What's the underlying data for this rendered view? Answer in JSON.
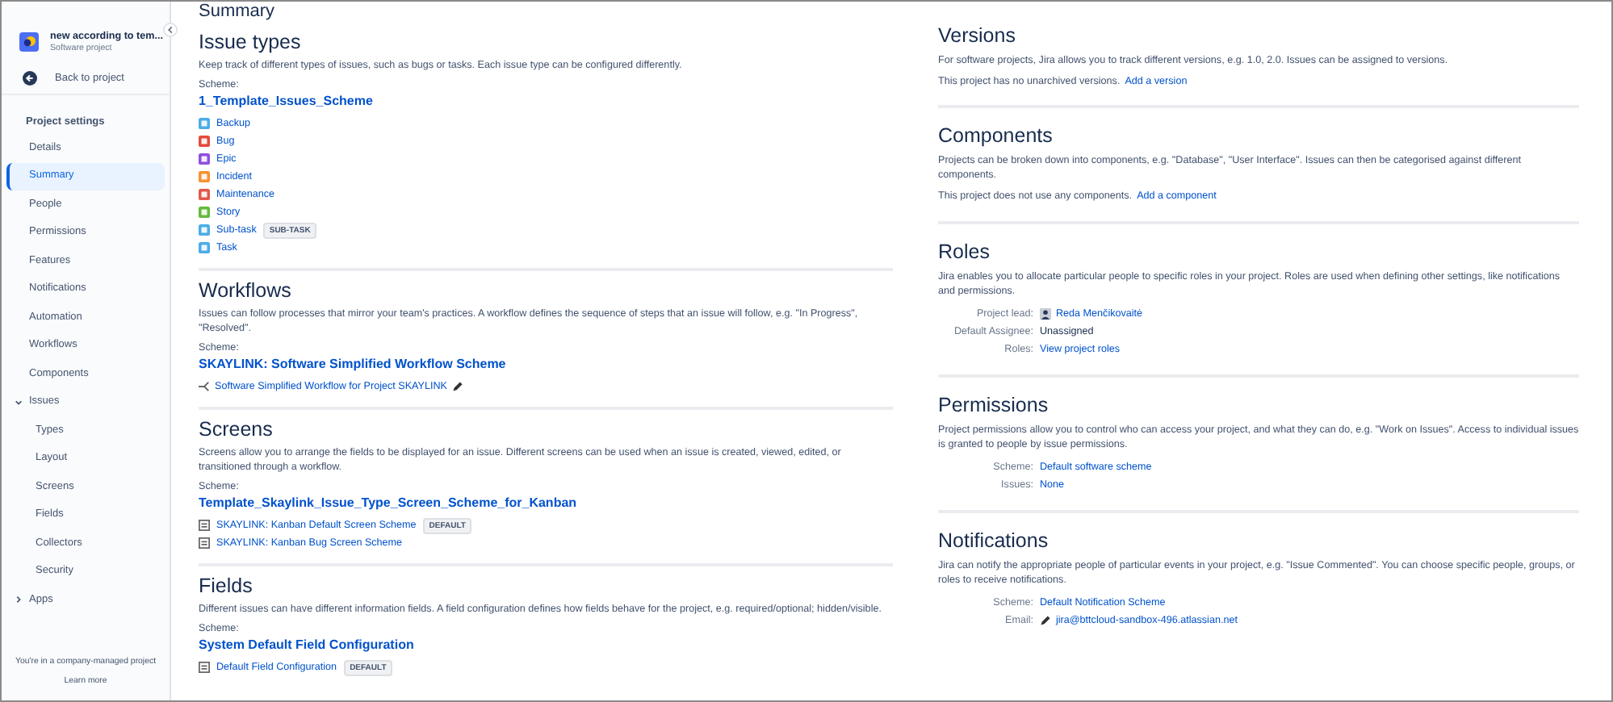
{
  "sidebar": {
    "project": {
      "name": "new according to tem...",
      "type": "Software project"
    },
    "back_label": "Back to project",
    "section_title": "Project settings",
    "items": [
      {
        "label": "Details",
        "selected": false
      },
      {
        "label": "Summary",
        "selected": true
      },
      {
        "label": "People",
        "selected": false
      },
      {
        "label": "Permissions",
        "selected": false
      },
      {
        "label": "Features",
        "selected": false
      },
      {
        "label": "Notifications",
        "selected": false
      },
      {
        "label": "Automation",
        "selected": false
      },
      {
        "label": "Workflows",
        "selected": false
      },
      {
        "label": "Components",
        "selected": false
      },
      {
        "label": "Issues",
        "selected": false,
        "expanded": true,
        "children": [
          {
            "label": "Types",
            "selected": false
          },
          {
            "label": "Layout",
            "selected": false
          },
          {
            "label": "Screens",
            "selected": false
          },
          {
            "label": "Fields",
            "selected": false
          },
          {
            "label": "Collectors",
            "selected": false
          },
          {
            "label": "Security",
            "selected": false
          }
        ]
      },
      {
        "label": "Apps",
        "selected": false,
        "expanded": false
      }
    ],
    "footer": {
      "text": "You're in a company-managed project",
      "link": "Learn more"
    }
  },
  "page_title": "Summary",
  "left_sections": [
    {
      "kind": "issue_types",
      "title": "Issue types",
      "description": "Keep track of different types of issues, such as bugs or tasks. Each issue type can be configured differently.",
      "scheme_label": "Scheme:",
      "scheme": "1_Template_Issues_Scheme",
      "items": [
        {
          "name": "Backup",
          "color": "#4bade8"
        },
        {
          "name": "Bug",
          "color": "#e5493a"
        },
        {
          "name": "Epic",
          "color": "#904ee2"
        },
        {
          "name": "Incident",
          "color": "#f79232"
        },
        {
          "name": "Maintenance",
          "color": "#e2574c"
        },
        {
          "name": "Story",
          "color": "#63ba3c"
        },
        {
          "name": "Sub-task",
          "color": "#4bade8",
          "badge": "SUB-TASK"
        },
        {
          "name": "Task",
          "color": "#4bade8"
        }
      ]
    },
    {
      "kind": "workflows",
      "title": "Workflows",
      "description": "Issues can follow processes that mirror your team's practices. A workflow defines the sequence of steps that an issue will follow, e.g. \"In Progress\", \"Resolved\".",
      "scheme_label": "Scheme:",
      "scheme": "SKAYLINK: Software Simplified Workflow Scheme",
      "items": [
        {
          "name": "Software Simplified Workflow for Project SKAYLINK",
          "editable": true
        }
      ]
    },
    {
      "kind": "screens",
      "title": "Screens",
      "description": "Screens allow you to arrange the fields to be displayed for an issue. Different screens can be used when an issue is created, viewed, edited, or transitioned through a workflow.",
      "scheme_label": "Scheme:",
      "scheme": "Template_Skaylink_Issue_Type_Screen_Scheme_for_Kanban",
      "items": [
        {
          "name": "SKAYLINK: Kanban Default Screen Scheme",
          "badge": "DEFAULT"
        },
        {
          "name": "SKAYLINK: Kanban Bug Screen Scheme"
        }
      ]
    },
    {
      "kind": "fields",
      "title": "Fields",
      "description": "Different issues can have different information fields. A field configuration defines how fields behave for the project, e.g. required/optional; hidden/visible.",
      "scheme_label": "Scheme:",
      "scheme": "System Default Field Configuration",
      "items": [
        {
          "name": "Default Field Configuration",
          "badge": "DEFAULT"
        }
      ]
    }
  ],
  "right_sections": [
    {
      "title": "Versions",
      "description": "For software projects, Jira allows you to track different versions, e.g. 1.0, 2.0. Issues can be assigned to versions.",
      "status": "This project has no unarchived versions.",
      "link": "Add a version"
    },
    {
      "title": "Components",
      "description": "Projects can be broken down into components, e.g. \"Database\", \"User Interface\". Issues can then be categorised against different components.",
      "status": "This project does not use any components.",
      "link": "Add a component"
    },
    {
      "title": "Roles",
      "description": "Jira enables you to allocate particular people to specific roles in your project. Roles are used when defining other settings, like notifications and permissions.",
      "rows": [
        {
          "label": "Project lead:",
          "value": "Reda Menčikovaitė",
          "kind": "user"
        },
        {
          "label": "Default Assignee:",
          "value": "Unassigned",
          "kind": "text"
        },
        {
          "label": "Roles:",
          "value": "View project roles",
          "kind": "link"
        }
      ]
    },
    {
      "title": "Permissions",
      "description": "Project permissions allow you to control who can access your project, and what they can do, e.g. \"Work on Issues\". Access to individual issues is granted to people by issue permissions.",
      "rows": [
        {
          "label": "Scheme:",
          "value": "Default software scheme",
          "kind": "link"
        },
        {
          "label": "Issues:",
          "value": "None",
          "kind": "link"
        }
      ]
    },
    {
      "title": "Notifications",
      "description": "Jira can notify the appropriate people of particular events in your project, e.g. \"Issue Commented\". You can choose specific people, groups, or roles to receive notifications.",
      "rows": [
        {
          "label": "Scheme:",
          "value": "Default Notification Scheme",
          "kind": "link"
        },
        {
          "label": "Email:",
          "value": "jira@bttcloud-sandbox-496.atlassian.net",
          "kind": "email"
        }
      ]
    }
  ]
}
